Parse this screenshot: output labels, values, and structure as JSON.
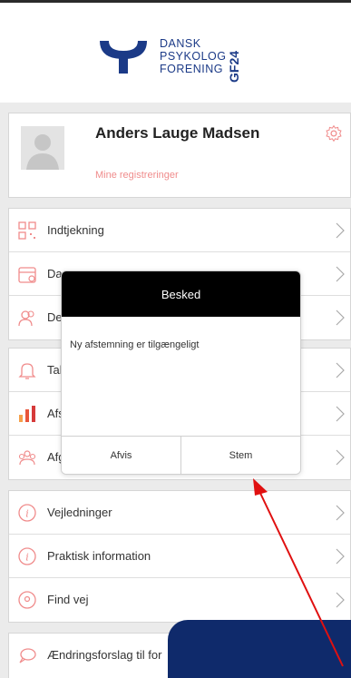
{
  "logo": {
    "line1": "DANSK",
    "line2": "PSYKOLOG",
    "line3": "FORENING",
    "badge": "GF24"
  },
  "profile": {
    "name": "Anders Lauge Madsen",
    "link": "Mine registreringer"
  },
  "group1": [
    {
      "label": "Indtjekning",
      "icon": "qr-code-icon"
    },
    {
      "label": "Dag",
      "icon": "calendar-icon"
    },
    {
      "label": "De",
      "icon": "people-icon"
    }
  ],
  "group2": [
    {
      "label": "Tal",
      "icon": "bell-icon"
    },
    {
      "label": "Afs",
      "icon": "bar-chart-icon"
    },
    {
      "label": "Afg",
      "icon": "group-icon"
    }
  ],
  "group3": [
    {
      "label": "Vejledninger",
      "icon": "info-icon"
    },
    {
      "label": "Praktisk information",
      "icon": "info-icon"
    },
    {
      "label": "Find vej",
      "icon": "location-pin-icon"
    }
  ],
  "group4": [
    {
      "label": "Ændringsforslag til for",
      "icon": "speech-bubble-icon"
    }
  ],
  "modal": {
    "title": "Besked",
    "message": "Ny afstemning er tilgængeligt",
    "reject_label": "Afvis",
    "vote_label": "Stem"
  },
  "colors": {
    "brand": "#1b3a87",
    "accent": "#f08c8c",
    "annotation": "#e01010",
    "panel": "#0f2a6b"
  }
}
